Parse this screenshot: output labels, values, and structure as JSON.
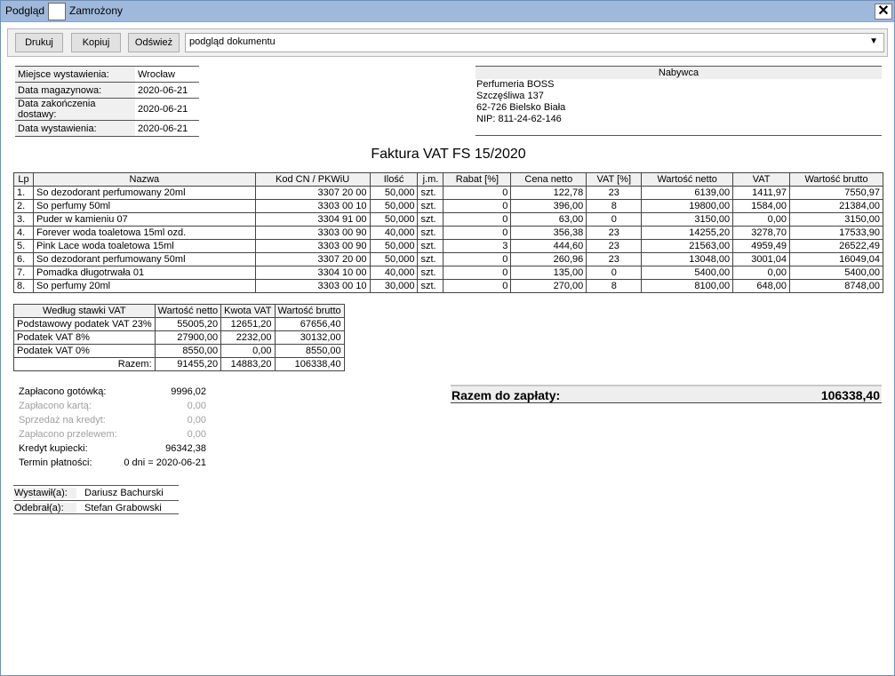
{
  "window": {
    "title": "Podgląd",
    "checkbox_label": "Zamrożony",
    "close_glyph": "✕"
  },
  "toolbar": {
    "print_label": "Drukuj",
    "copy_label": "Kopiuj",
    "refresh_label": "Odśwież",
    "view_select_value": "podgląd dokumentu"
  },
  "info": [
    {
      "label": "Miejsce wystawienia:",
      "value": "Wrocław"
    },
    {
      "label": "Data magazynowa:",
      "value": "2020-06-21"
    },
    {
      "label": "Data zakończenia dostawy:",
      "value": "2020-06-21"
    },
    {
      "label": "Data wystawienia:",
      "value": "2020-06-21"
    }
  ],
  "buyer": {
    "header": "Nabywca",
    "lines": [
      "Perfumeria BOSS",
      "Szczęśliwa 137",
      "62-726 Bielsko Biała",
      "NIP: 811-24-62-146"
    ]
  },
  "document_title": "Faktura VAT FS 15/2020",
  "items": {
    "headers": [
      "Lp",
      "Nazwa",
      "Kod CN / PKWiU",
      "Ilość",
      "j.m.",
      "Rabat [%]",
      "Cena netto",
      "VAT [%]",
      "Wartość netto",
      "VAT",
      "Wartość brutto"
    ],
    "rows": [
      [
        "1.",
        "So dezodorant perfumowany 20ml",
        "3307 20 00",
        "50,000",
        "szt.",
        "0",
        "122,78",
        "23",
        "6139,00",
        "1411,97",
        "7550,97"
      ],
      [
        "2.",
        "So perfumy 50ml",
        "3303 00 10",
        "50,000",
        "szt.",
        "0",
        "396,00",
        "8",
        "19800,00",
        "1584,00",
        "21384,00"
      ],
      [
        "3.",
        "Puder w kamieniu 07",
        "3304 91 00",
        "50,000",
        "szt.",
        "0",
        "63,00",
        "0",
        "3150,00",
        "0,00",
        "3150,00"
      ],
      [
        "4.",
        "Forever woda toaletowa 15ml ozd.",
        "3303 00 90",
        "40,000",
        "szt.",
        "0",
        "356,38",
        "23",
        "14255,20",
        "3278,70",
        "17533,90"
      ],
      [
        "5.",
        "Pink Lace woda toaletowa 15ml",
        "3303 00 90",
        "50,000",
        "szt.",
        "3",
        "444,60",
        "23",
        "21563,00",
        "4959,49",
        "26522,49"
      ],
      [
        "6.",
        "So dezodorant perfumowany 50ml",
        "3307 20 00",
        "50,000",
        "szt.",
        "0",
        "260,96",
        "23",
        "13048,00",
        "3001,04",
        "16049,04"
      ],
      [
        "7.",
        "Pomadka długotrwała 01",
        "3304 10 00",
        "40,000",
        "szt.",
        "0",
        "135,00",
        "0",
        "5400,00",
        "0,00",
        "5400,00"
      ],
      [
        "8.",
        "So perfumy 20ml",
        "3303 00 10",
        "30,000",
        "szt.",
        "0",
        "270,00",
        "8",
        "8100,00",
        "648,00",
        "8748,00"
      ]
    ]
  },
  "vat_summary": {
    "headers": [
      "Według stawki VAT",
      "Wartość netto",
      "Kwota VAT",
      "Wartość brutto"
    ],
    "rows": [
      [
        "Podstawowy podatek VAT 23%",
        "55005,20",
        "12651,20",
        "67656,40"
      ],
      [
        "Podatek VAT 8%",
        "27900,00",
        "2232,00",
        "30132,00"
      ],
      [
        "Podatek VAT 0%",
        "8550,00",
        "0,00",
        "8550,00"
      ],
      [
        "Razem:",
        "91455,20",
        "14883,20",
        "106338,40"
      ]
    ]
  },
  "payments": [
    {
      "label": "Zapłacono gotówką:",
      "value": "9996,02",
      "muted": false
    },
    {
      "label": "Zapłacono kartą:",
      "value": "0,00",
      "muted": true
    },
    {
      "label": "Sprzedaż na kredyt:",
      "value": "0,00",
      "muted": true
    },
    {
      "label": "Zapłacono przelewem:",
      "value": "0,00",
      "muted": true
    },
    {
      "label": "Kredyt kupiecki:",
      "value": "96342,38",
      "muted": false
    },
    {
      "label": "Termin płatności:",
      "value": "0 dni = 2020-06-21",
      "muted": false
    }
  ],
  "total": {
    "label": "Razem do zapłaty:",
    "value": "106338,40"
  },
  "signatures": [
    {
      "label": "Wystawił(a):",
      "value": "Dariusz Bachurski"
    },
    {
      "label": "Odebrał(a):",
      "value": "Stefan Grabowski"
    }
  ]
}
